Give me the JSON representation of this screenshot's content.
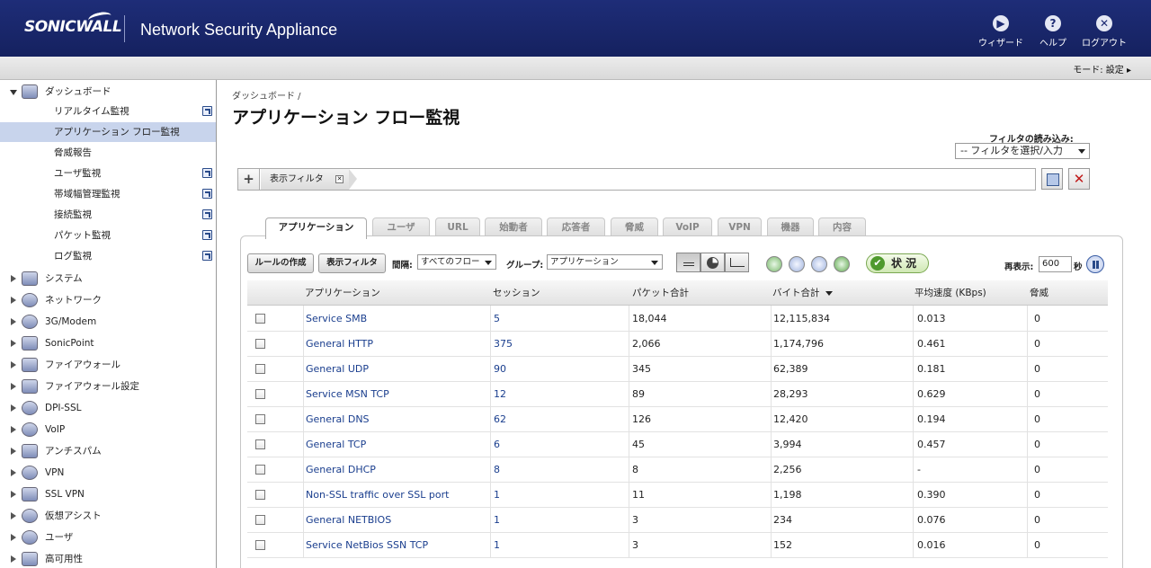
{
  "header": {
    "logo": "SONICWALL",
    "product": "Network Security Appliance",
    "wizard_label": "ウィザード",
    "help_label": "ヘルプ",
    "logout_label": "ログアウト",
    "mode_text": "モード: 設定 ▸"
  },
  "sidebar": {
    "dashboard": "ダッシュボード",
    "sub_items": [
      {
        "label": "リアルタイム監視"
      },
      {
        "label": "アプリケーション フロー監視"
      },
      {
        "label": "脅威報告"
      },
      {
        "label": "ユーザ監視"
      },
      {
        "label": "帯域幅管理監視"
      },
      {
        "label": "接続監視"
      },
      {
        "label": "パケット監視"
      },
      {
        "label": "ログ監視"
      }
    ],
    "sections": [
      {
        "label": "システム"
      },
      {
        "label": "ネットワーク"
      },
      {
        "label": "3G/Modem"
      },
      {
        "label": "SonicPoint"
      },
      {
        "label": "ファイアウォール"
      },
      {
        "label": "ファイアウォール設定"
      },
      {
        "label": "DPI-SSL"
      },
      {
        "label": "VoIP"
      },
      {
        "label": "アンチスパム"
      },
      {
        "label": "VPN"
      },
      {
        "label": "SSL VPN"
      },
      {
        "label": "仮想アシスト"
      },
      {
        "label": "ユーザ"
      },
      {
        "label": "高可用性"
      }
    ]
  },
  "main": {
    "breadcrumb": "ダッシュボード /",
    "title": "アプリケーション フロー監視",
    "filter_load_label": "フィルタの読み込み:",
    "filter_select_value": "-- フィルタを選択/入力",
    "filter_tag": "表示フィルタ",
    "tabs": [
      "アプリケーション",
      "ユーザ",
      "URL",
      "始動者",
      "応答者",
      "脅威",
      "VoIP",
      "VPN",
      "機器",
      "内容"
    ],
    "toolbar": {
      "create_rule": "ルールの作成",
      "display_filter": "表示フィルタ",
      "interval_label": "間隔:",
      "interval_value": "すべてのフロー",
      "group_label": "グループ:",
      "group_value": "アプリケーション",
      "status_label": "状 況",
      "refresh_label": "再表示:",
      "refresh_value": "600",
      "seconds_label": "秒"
    },
    "table": {
      "headers": [
        "アプリケーション",
        "セッション",
        "パケット合計",
        "バイト合計",
        "平均速度 (KBps)",
        "脅威"
      ],
      "rows": [
        {
          "app": "Service SMB",
          "sessions": "5",
          "packets": "18,044",
          "bytes": "12,115,834",
          "rate": "0.013",
          "threats": "0"
        },
        {
          "app": "General HTTP",
          "sessions": "375",
          "packets": "2,066",
          "bytes": "1,174,796",
          "rate": "0.461",
          "threats": "0"
        },
        {
          "app": "General UDP",
          "sessions": "90",
          "packets": "345",
          "bytes": "62,389",
          "rate": "0.181",
          "threats": "0"
        },
        {
          "app": "Service MSN TCP",
          "sessions": "12",
          "packets": "89",
          "bytes": "28,293",
          "rate": "0.629",
          "threats": "0"
        },
        {
          "app": "General DNS",
          "sessions": "62",
          "packets": "126",
          "bytes": "12,420",
          "rate": "0.194",
          "threats": "0"
        },
        {
          "app": "General TCP",
          "sessions": "6",
          "packets": "45",
          "bytes": "3,994",
          "rate": "0.457",
          "threats": "0"
        },
        {
          "app": "General DHCP",
          "sessions": "8",
          "packets": "8",
          "bytes": "2,256",
          "rate": "-",
          "threats": "0"
        },
        {
          "app": "Non-SSL traffic over SSL port",
          "sessions": "1",
          "packets": "11",
          "bytes": "1,198",
          "rate": "0.390",
          "threats": "0"
        },
        {
          "app": "General NETBIOS",
          "sessions": "1",
          "packets": "3",
          "bytes": "234",
          "rate": "0.076",
          "threats": "0"
        },
        {
          "app": "Service NetBios SSN TCP",
          "sessions": "1",
          "packets": "3",
          "bytes": "152",
          "rate": "0.016",
          "threats": "0"
        }
      ]
    }
  },
  "colors": {
    "header_bg": "#1e2d78",
    "active_nav": "#c8d4ec",
    "link": "#1a3e8e",
    "status_green": "#4f9a2e"
  }
}
